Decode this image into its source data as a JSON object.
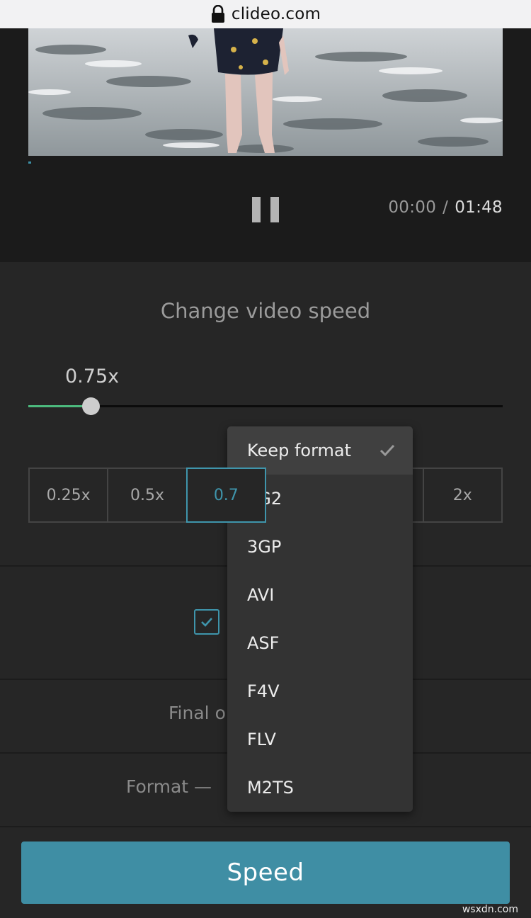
{
  "browser": {
    "url": "clideo.com"
  },
  "player": {
    "time_current": "00:00",
    "time_separator": "/",
    "time_total": "01:48",
    "progress_fraction": 0.0
  },
  "speed_settings": {
    "heading": "Change video speed",
    "current_speed_label": "0.75x",
    "slider_fraction": 0.13,
    "presets": [
      "0.25x",
      "0.5x",
      "0.7",
      "",
      "",
      "2x"
    ],
    "active_preset_index": 2
  },
  "options": {
    "final_label_partial": "Final o",
    "format_label_partial": "Format —"
  },
  "format_dropdown": {
    "selected": "Keep format",
    "items": [
      "Keep format",
      "3G2",
      "3GP",
      "AVI",
      "ASF",
      "F4V",
      "FLV",
      "M2TS"
    ]
  },
  "action": {
    "button_label": "Speed"
  },
  "watermark": "wsxdn.com",
  "colors": {
    "accent": "#3f8ea4",
    "slider_fill": "#4cba7e",
    "background": "#262626"
  }
}
